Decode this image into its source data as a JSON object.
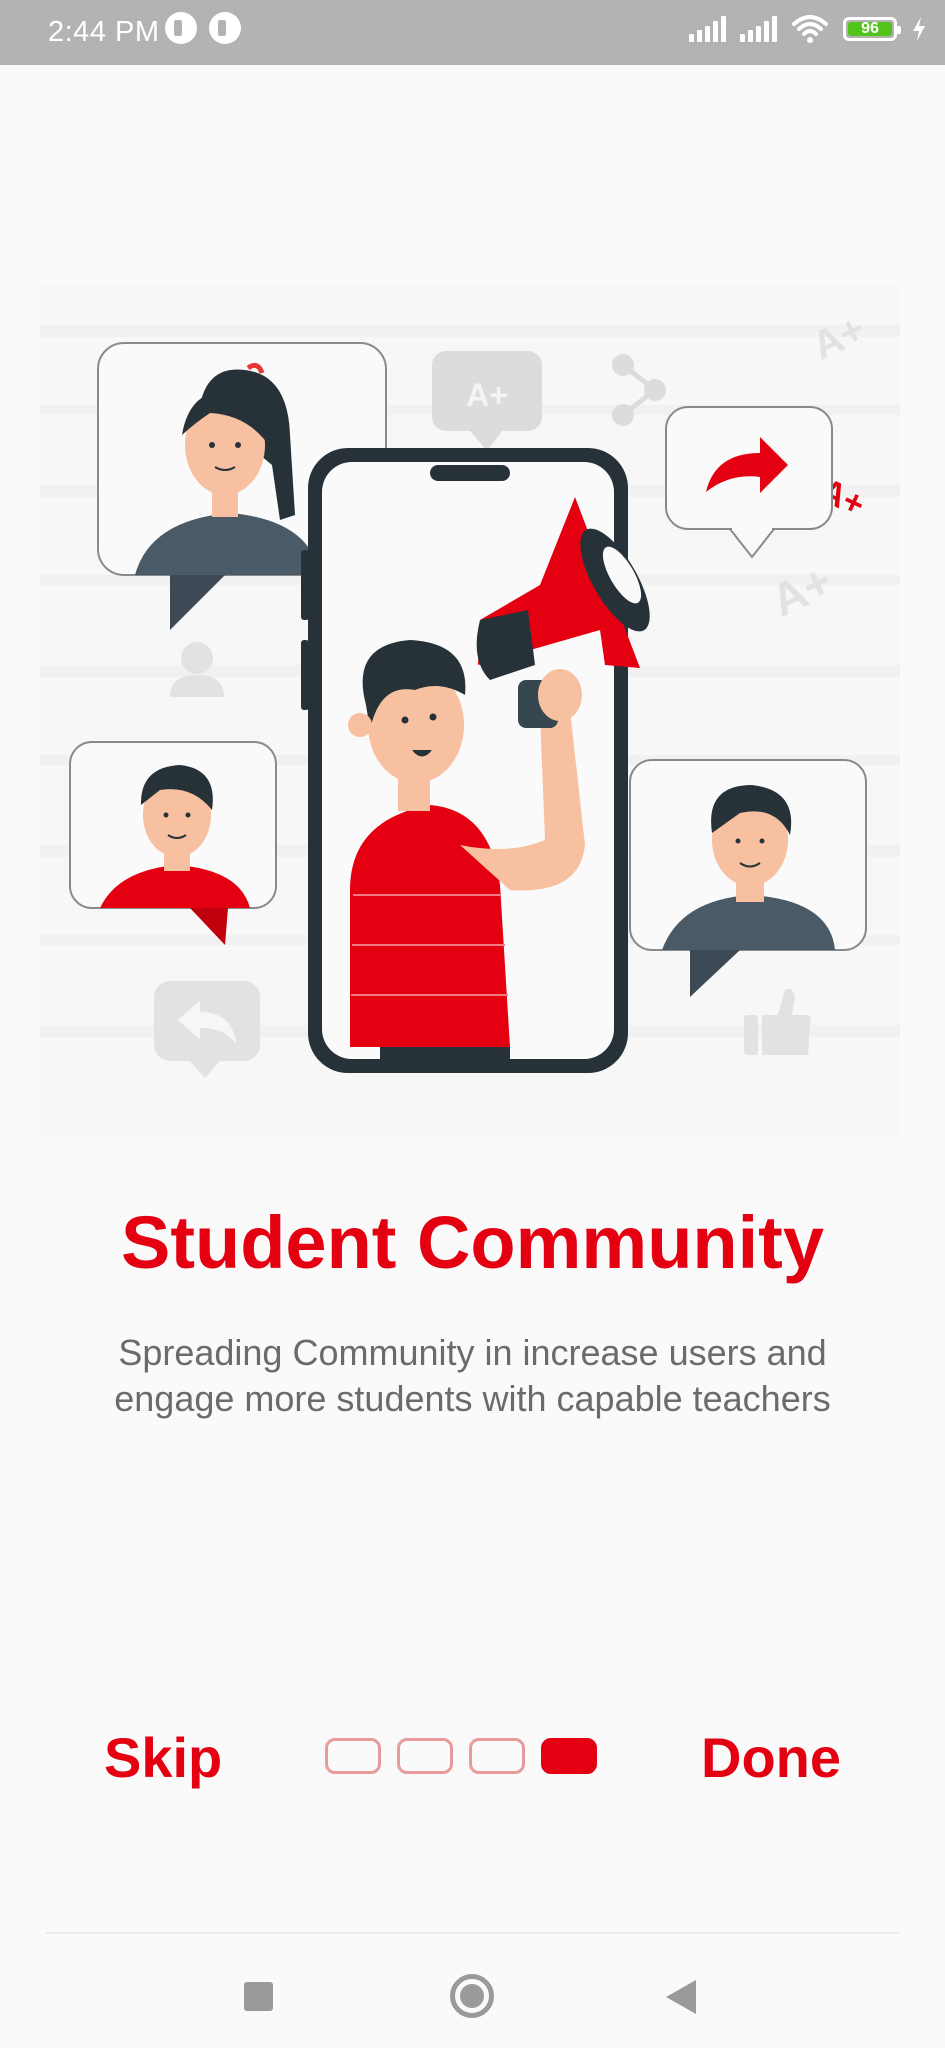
{
  "status_bar": {
    "time": "2:44 PM",
    "battery_level": "96",
    "icons": [
      "notification-icon",
      "notification-icon",
      "signal-icon",
      "signal-icon",
      "wifi-icon",
      "battery-icon",
      "charging-icon"
    ]
  },
  "illustration": {
    "icons": [
      "person-woman-bubble",
      "person-man-bubble",
      "person-man-bubble",
      "phone-with-man-megaphone",
      "share-arrow-bubble",
      "grade-a-plus-bubble",
      "reply-bubble",
      "thumbs-up-icon",
      "user-icon",
      "share-icon"
    ],
    "grade_marks": [
      "A+",
      "A+",
      "A+",
      "A+"
    ],
    "accent_color": "#e40010"
  },
  "onboarding": {
    "title": "Student Community",
    "description_line1": "Spreading Community in increase users and",
    "description_line2": "engage more students with capable teachers"
  },
  "controls": {
    "skip_label": "Skip",
    "done_label": "Done",
    "pages_total": 4,
    "current_page": 4
  },
  "nav_bar": {
    "icons": [
      "recents-icon",
      "home-icon",
      "back-icon"
    ]
  },
  "colors": {
    "primary": "#e40010",
    "text_secondary": "#6b6b6b",
    "background": "#fafafa",
    "status_bar": "#b3b3b3"
  }
}
